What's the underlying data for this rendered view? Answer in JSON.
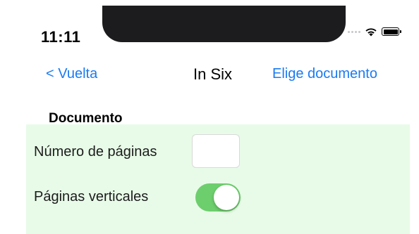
{
  "status_bar": {
    "time": "11:11",
    "icons": [
      "cellular-signal-icon",
      "wifi-icon",
      "battery-icon"
    ]
  },
  "nav": {
    "back_label": "< Vuelta",
    "title": "In Six",
    "action_label": "Elige documento"
  },
  "section": {
    "header": "Documento",
    "pages_label": "Número de páginas",
    "pages_value": "",
    "vertical_label": "Páginas verticales",
    "vertical_enabled": true
  },
  "colors": {
    "accent": "#1a7bf2",
    "panel_bg": "#e8fbe8",
    "toggle_on": "#6dce6d"
  }
}
